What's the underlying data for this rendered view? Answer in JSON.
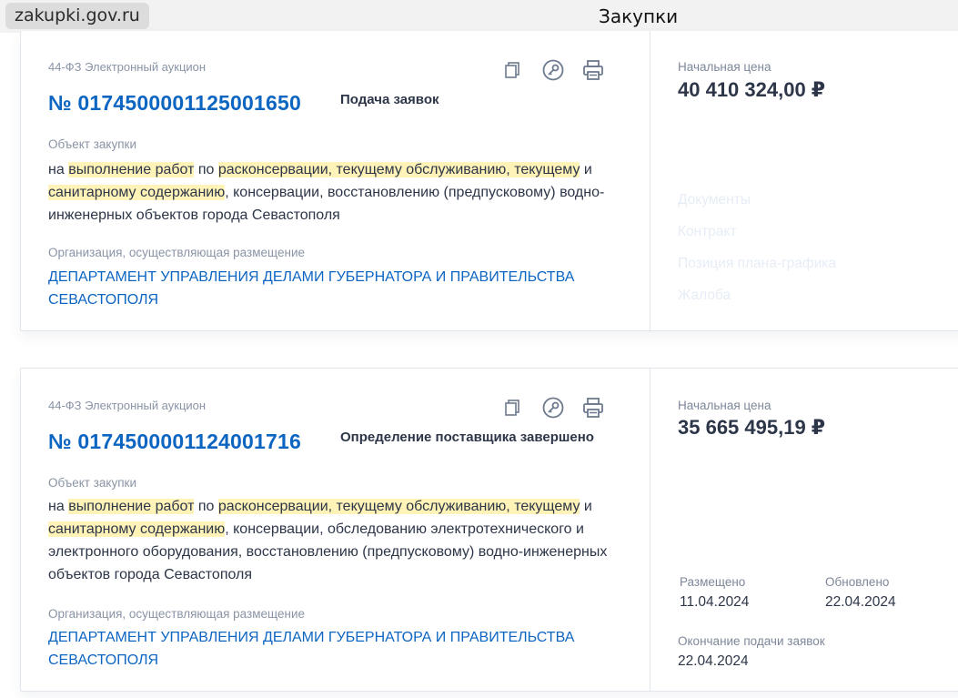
{
  "browser": {
    "url": "zakupki.gov.ru",
    "title": "Закупки"
  },
  "cards": [
    {
      "law": "44-ФЗ Электронный аукцион",
      "number": "№ 0174500001125001650",
      "status": "Подача заявок",
      "object_label": "Объект закупки",
      "desc_parts": [
        {
          "t": "на "
        },
        {
          "t": "выполнение работ",
          "hl": true
        },
        {
          "t": " по "
        },
        {
          "t": "расконсервации, текущему обслуживанию, текущему",
          "hl": true
        },
        {
          "t": " и "
        },
        {
          "t": "санитарному содержанию",
          "hl": true
        },
        {
          "t": ", консервации, восстановлению (предпусковому) водно-инженерных объектов города Севастополя"
        }
      ],
      "org_label": "Организация, осуществляющая размещение",
      "org": "ДЕПАРТАМЕНТ УПРАВЛЕНИЯ ДЕЛАМИ ГУБЕРНАТОРА И ПРАВИТЕЛЬСТВА СЕВАСТОПОЛЯ",
      "price_label": "Начальная цена",
      "price": "40 410 324,00 ₽",
      "links": [
        "Документы",
        "Контракт",
        "Позиция плана-графика",
        "Жалоба"
      ]
    },
    {
      "law": "44-ФЗ Электронный аукцион",
      "number": "№ 0174500001124001716",
      "status": "Определение поставщика завершено",
      "object_label": "Объект закупки",
      "desc_parts": [
        {
          "t": "на "
        },
        {
          "t": "выполнение работ",
          "hl": true
        },
        {
          "t": " по "
        },
        {
          "t": "расконсервации, текущему обслуживанию, текущему",
          "hl": true
        },
        {
          "t": " и "
        },
        {
          "t": "санитарному содержанию",
          "hl": true
        },
        {
          "t": ", консервации, обследованию электротехнического и электронного оборудования, восстановлению (предпусковому) водно-инженерных объектов города Севастополя"
        }
      ],
      "org_label": "Организация, осуществляющая размещение",
      "org": "ДЕПАРТАМЕНТ УПРАВЛЕНИЯ ДЕЛАМИ ГУБЕРНАТОРА И ПРАВИТЕЛЬСТВА СЕВАСТОПОЛЯ",
      "price_label": "Начальная цена",
      "price": "35 665 495,19 ₽",
      "posted_label": "Размещено",
      "posted": "11.04.2024",
      "updated_label": "Обновлено",
      "updated": "22.04.2024",
      "deadline_label": "Окончание подачи заявок",
      "deadline": "22.04.2024"
    }
  ],
  "icons": {
    "copy": "copy-icon",
    "key": "key-icon",
    "print": "print-icon"
  },
  "colors": {
    "accent": "#0d65c2",
    "highlight": "#fff3b8",
    "muted": "#8a94a6"
  }
}
